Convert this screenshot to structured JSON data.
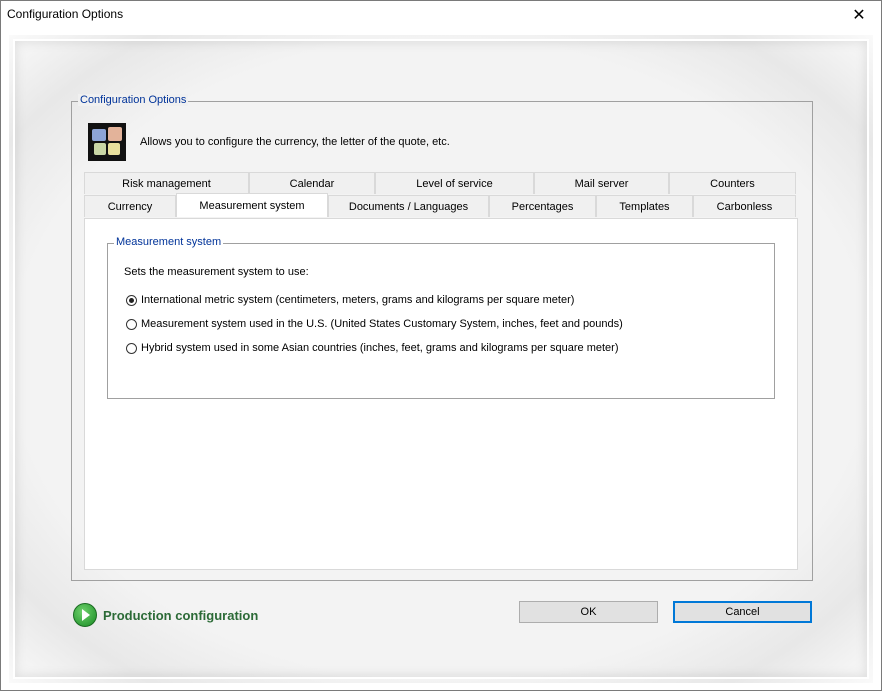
{
  "window": {
    "title": "Configuration Options",
    "close_glyph": "✕"
  },
  "group": {
    "legend": "Configuration Options",
    "description": "Allows you to configure the currency, the letter of the quote, etc."
  },
  "tabs": {
    "row1": [
      "Risk management",
      "Calendar",
      "Level of service",
      "Mail server",
      "Counters"
    ],
    "row2": [
      "Currency",
      "Measurement system",
      "Documents / Languages",
      "Percentages",
      "Templates",
      "Carbonless"
    ],
    "active": "Measurement system"
  },
  "measurement": {
    "legend": "Measurement system",
    "prompt": "Sets the measurement system to use:",
    "options": [
      {
        "label": "International metric system (centimeters, meters, grams and kilograms per square meter)",
        "checked": true
      },
      {
        "label": "Measurement system used in the U.S. (United States Customary System, inches, feet and pounds)",
        "checked": false
      },
      {
        "label": "Hybrid system used in some Asian countries (inches, feet, grams and kilograms per square meter)",
        "checked": false
      }
    ]
  },
  "footer": {
    "production_label": "Production configuration",
    "ok_label": "OK",
    "cancel_label": "Cancel"
  },
  "icons": {
    "close": "close-icon",
    "puzzle": "puzzle-icon",
    "play": "play-circle-icon"
  }
}
